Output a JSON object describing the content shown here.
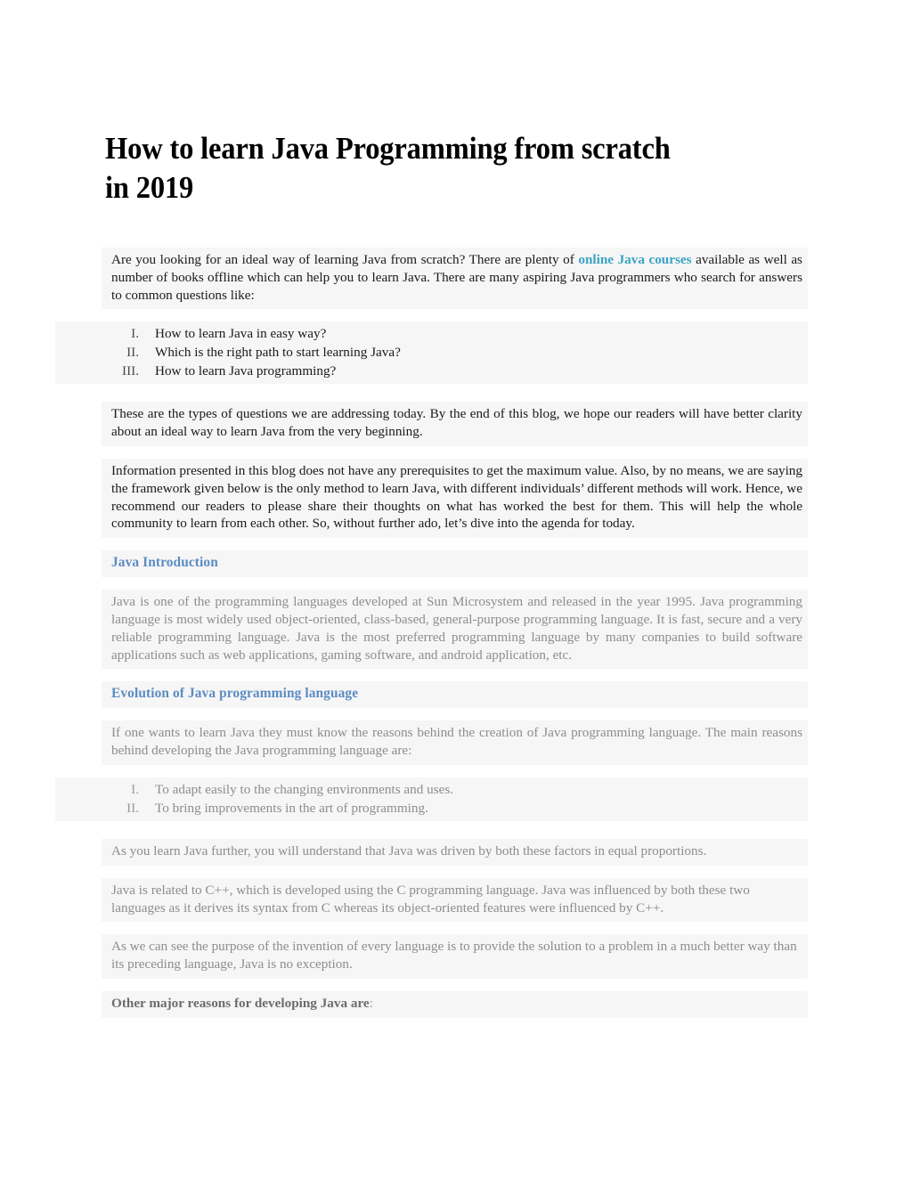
{
  "document": {
    "title": "How to learn Java Programming from scratch in 2019",
    "colors": {
      "link": "#3aa3c4",
      "heading": "#5b8cc2",
      "body_dark": "#1a1a1a",
      "body_light": "#8d8d8d",
      "block_background": "#f6f6f6",
      "page_background": "#ffffff"
    }
  },
  "intro": {
    "part1": "Are you looking for an ideal way of learning Java from scratch? There are plenty of ",
    "link_text": "online Java courses",
    "part2": " available as well as number of books offline which can help you to learn Java. There are many aspiring Java programmers who search for answers to common questions like:"
  },
  "questions_list": [
    {
      "num": "I.",
      "text": "How to learn Java in easy way?"
    },
    {
      "num": "II.",
      "text": "Which is the right path to start learning Java?"
    },
    {
      "num": "III.",
      "text": "How to learn Java programming?"
    }
  ],
  "paragraphs": {
    "addressing": "These are the types of questions we are addressing today. By the end of this blog, we hope our readers will have better clarity about an ideal way to learn Java from the very beginning.",
    "information": "Information presented in this blog does not have any prerequisites to get the maximum value. Also, by no means, we are saying the framework given below is the only method to learn Java, with different individuals’ different methods will work. Hence, we recommend our readers to please share their thoughts on what has worked the best for them. This will help the whole community to learn from each other. So, without further ado, let’s dive into the agenda for today.",
    "java_intro_body": "Java is one of the programming languages developed at Sun Microsystem and released in the year 1995. Java programming language is most widely used object-oriented, class-based, general-purpose programming language. It is fast, secure and a very reliable programming language. Java is the most preferred programming language by many companies to build software applications such as web applications, gaming software, and android application, etc.",
    "evolution_body": "If one wants to learn Java they must know the reasons behind the creation of Java programming language. The main reasons behind developing the Java programming language are:",
    "factors": "As you learn Java further, you will understand that Java was driven by both these factors in equal proportions.",
    "related_cpp": "Java is related to C++, which is developed using the C programming language. Java was influenced by both these two languages as it derives its syntax from C whereas its object-oriented features were influenced by C++.",
    "purpose": "As we can see the purpose of the invention of every language is to provide the solution to a problem in a much better way than its preceding language, Java is no exception."
  },
  "headings": {
    "java_introduction": "Java Introduction",
    "evolution": "Evolution of Java programming language"
  },
  "reasons_list": [
    {
      "num": "I.",
      "text": "To adapt easily to the changing environments and uses."
    },
    {
      "num": "II.",
      "text": "To bring improvements in the art of programming."
    }
  ],
  "closing": {
    "bold_text": "Other major reasons for developing Java are",
    "colon": ":"
  }
}
